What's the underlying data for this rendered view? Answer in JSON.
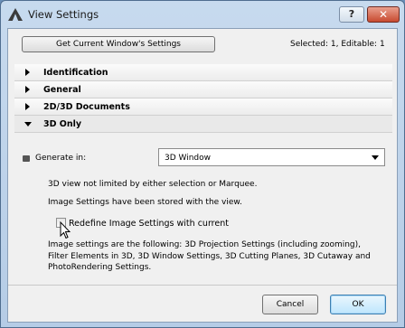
{
  "window": {
    "title": "View Settings",
    "help_label": "?",
    "close_label": "✕"
  },
  "header": {
    "get_settings_label": "Get Current Window's Settings",
    "selection_status": "Selected: 1, Editable: 1"
  },
  "sections": [
    {
      "label": "Identification",
      "expanded": false
    },
    {
      "label": "General",
      "expanded": false
    },
    {
      "label": "2D/3D Documents",
      "expanded": false
    },
    {
      "label": "3D Only",
      "expanded": true
    }
  ],
  "generate": {
    "label": "Generate in:",
    "selected": "3D Window"
  },
  "info": {
    "line1": "3D view not limited by either selection or Marquee.",
    "line2": "Image Settings have been stored with the view.",
    "checkbox_label": "Redefine Image Settings with current",
    "checkbox_checked": false,
    "desc_line1": "Image settings are the following: 3D Projection Settings (including zooming),",
    "desc_line2": "Filter Elements in 3D, 3D Window Settings, 3D Cutting Planes, 3D Cutaway and",
    "desc_line3": "PhotoRendering Settings."
  },
  "footer": {
    "cancel_label": "Cancel",
    "ok_label": "OK"
  },
  "colors": {
    "titlebar": "#b5cce6",
    "close_button": "#c84a30",
    "default_button": "#bee6fd"
  }
}
